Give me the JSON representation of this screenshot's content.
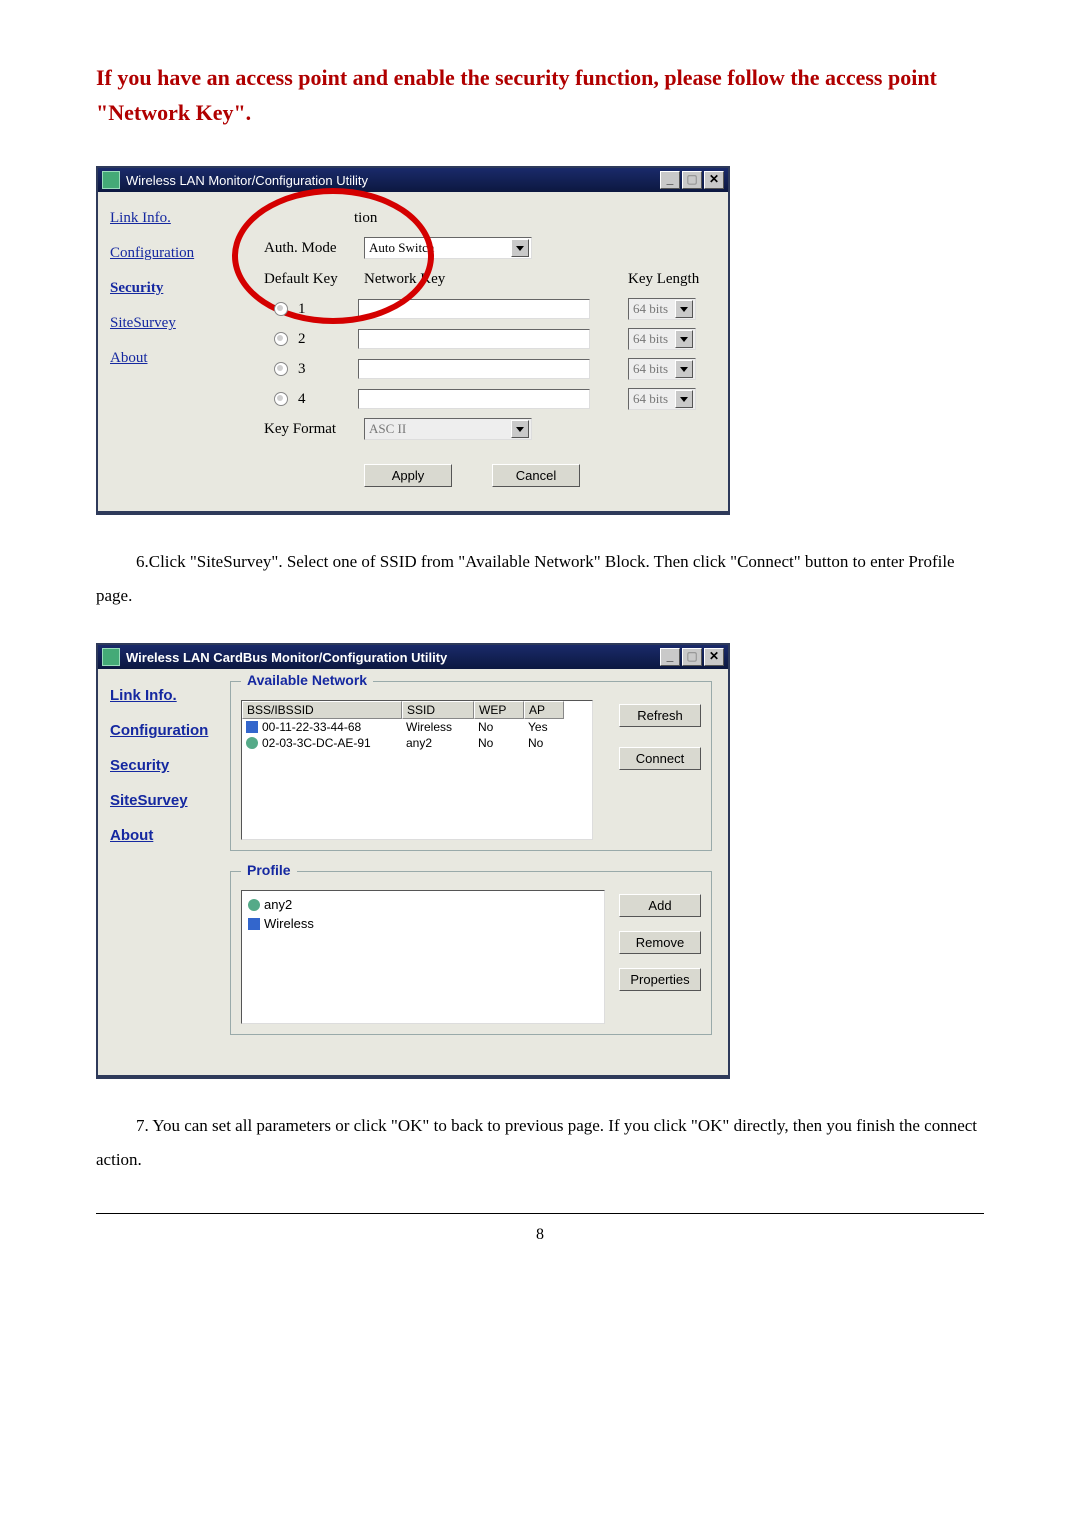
{
  "callout": "If you have an access point and enable the security function, please follow the access point \"Network Key\".",
  "screenshot1": {
    "window_title": "Wireless LAN Monitor/Configuration Utility",
    "nav": {
      "link_info": "Link Info.",
      "configuration": "Configuration",
      "security": "Security",
      "sitesurvey": "SiteSurvey",
      "about": "About"
    },
    "data_encryption_label": "tion",
    "auth_mode_label": "Auth. Mode",
    "auth_mode_value": "Auto Switch",
    "default_key_label": "Default Key",
    "network_key_label": "Network Key",
    "key_length_label": "Key Length",
    "keys": [
      {
        "slot": "1",
        "length": "64 bits"
      },
      {
        "slot": "2",
        "length": "64 bits"
      },
      {
        "slot": "3",
        "length": "64 bits"
      },
      {
        "slot": "4",
        "length": "64 bits"
      }
    ],
    "key_format_label": "Key Format",
    "key_format_value": "ASC II",
    "apply_label": "Apply",
    "cancel_label": "Cancel"
  },
  "step6": "6.Click \"SiteSurvey\". Select one of SSID from \"Available Network\" Block. Then click \"Connect\" button to enter Profile page.",
  "screenshot2": {
    "window_title": "Wireless LAN CardBus Monitor/Configuration Utility",
    "nav": {
      "link_info": "Link Info.",
      "configuration": "Configuration",
      "security": "Security",
      "sitesurvey": "SiteSurvey",
      "about": "About"
    },
    "available_network_legend": "Available Network",
    "columns": {
      "bss": "BSS/IBSSID",
      "ssid": "SSID",
      "wep": "WEP",
      "ap": "AP"
    },
    "rows": [
      {
        "bss": "00-11-22-33-44-68",
        "ssid": "Wireless",
        "wep": "No",
        "ap": "Yes"
      },
      {
        "bss": "02-03-3C-DC-AE-91",
        "ssid": "any2",
        "wep": "No",
        "ap": "No"
      }
    ],
    "refresh_label": "Refresh",
    "connect_label": "Connect",
    "profile_legend": "Profile",
    "profiles": [
      "any2",
      "Wireless"
    ],
    "add_label": "Add",
    "remove_label": "Remove",
    "properties_label": "Properties"
  },
  "step7": "7. You can set all parameters or click \"OK\" to back to previous page. If you click \"OK\" directly, then you finish the connect action.",
  "page_number": "8"
}
